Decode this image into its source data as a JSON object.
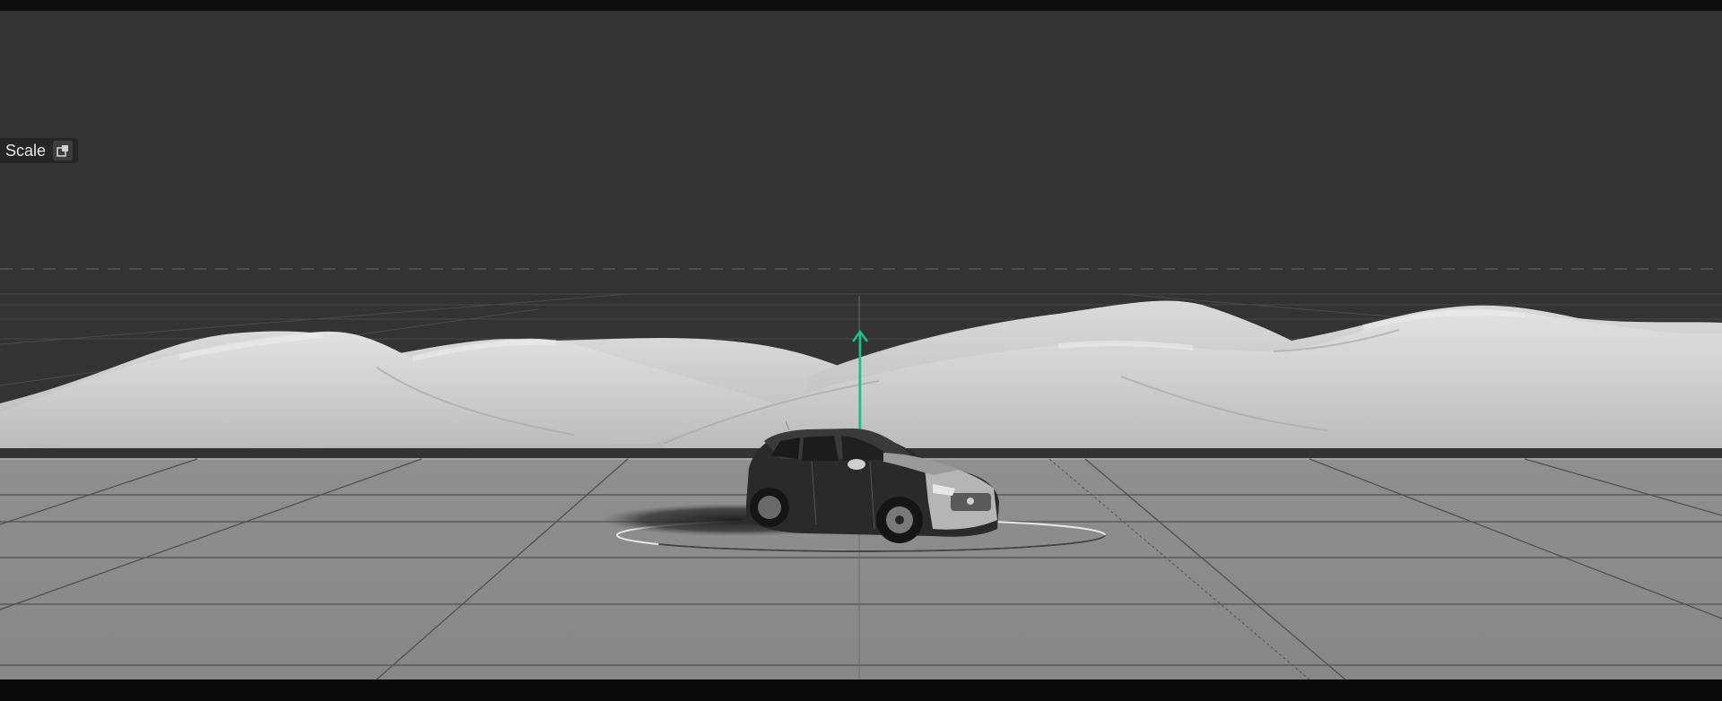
{
  "viewport": {
    "background": "#333333",
    "floor_color": "#8c8c8c",
    "dune_color": "#d6d6d6",
    "gizmo_color": "#18c28c"
  },
  "tool_panel": {
    "label": "Scale",
    "icon": "scale-tool-icon"
  }
}
